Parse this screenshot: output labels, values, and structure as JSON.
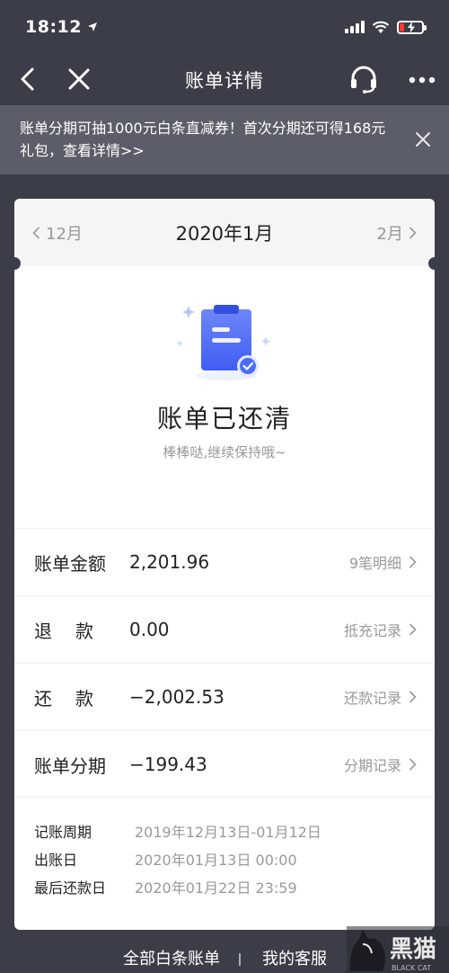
{
  "status_bar": {
    "time": "18:12"
  },
  "nav": {
    "title": "账单详情"
  },
  "banner": {
    "text": "账单分期可抽1000元白条直减券！首次分期还可得168元礼包，查看详情>>"
  },
  "month_bar": {
    "prev": "12月",
    "current": "2020年1月",
    "next": "2月"
  },
  "status": {
    "title": "账单已还清",
    "subtitle": "棒棒哒,继续保持哦~"
  },
  "rows": [
    {
      "label": "账单金额",
      "value": "2,201.96",
      "link": "9笔明细"
    },
    {
      "label": "退款",
      "value": "0.00",
      "link": "抵充记录"
    },
    {
      "label": "还款",
      "value": "−2,002.53",
      "link": "还款记录"
    },
    {
      "label": "账单分期",
      "value": "−199.43",
      "link": "分期记录"
    }
  ],
  "info": [
    {
      "label": "记账周期",
      "value": "2019年12月13日-01月12日"
    },
    {
      "label": "出账日",
      "value": "2020年01月13日 00:00"
    },
    {
      "label": "最后还款日",
      "value": "2020年01月22日 23:59"
    }
  ],
  "footer": {
    "left": "全部白条账单",
    "right": "我的客服"
  },
  "watermark": {
    "text": "黑猫",
    "sub": "BLACK CAT"
  },
  "colors": {
    "background": "#3b3e48",
    "accent": "#4a6cf7",
    "banner": "#5b5e68"
  }
}
